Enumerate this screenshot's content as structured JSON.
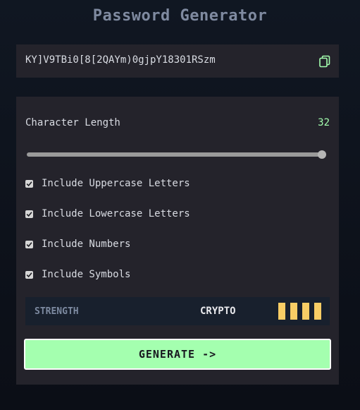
{
  "app": {
    "title": "Password Generator"
  },
  "output": {
    "password": "KY]V9TBi0[8[2QAYm)0gjpY18301RSzm",
    "copy_icon": "copy-icon"
  },
  "length": {
    "label": "Character Length",
    "value": "32",
    "slider_fraction": 1.0
  },
  "options": [
    {
      "label": "Include Uppercase Letters",
      "checked": true
    },
    {
      "label": "Include Lowercase Letters",
      "checked": true
    },
    {
      "label": "Include Numbers",
      "checked": true
    },
    {
      "label": "Include Symbols",
      "checked": true
    }
  ],
  "strength": {
    "label": "STRENGTH",
    "value": "CRYPTO",
    "bars_filled": 4,
    "bars_total": 4
  },
  "generate": {
    "label": "GENERATE ->"
  },
  "colors": {
    "accent": "#a4ffaf",
    "bar_fill": "#f8cd65",
    "panel": "#24232b",
    "strength_bg": "#18202d"
  }
}
